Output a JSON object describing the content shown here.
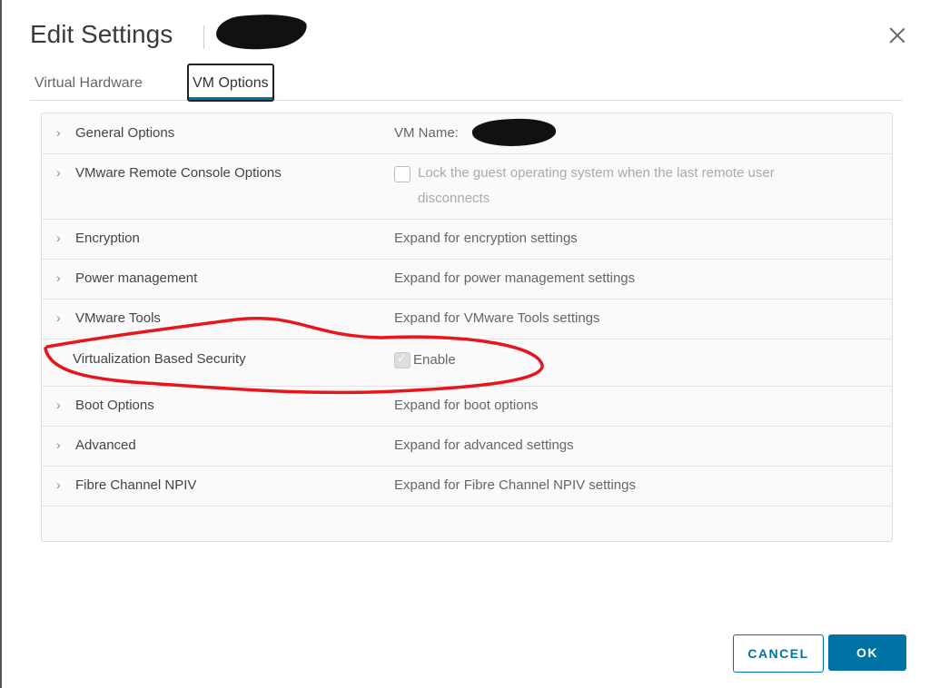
{
  "dialog": {
    "title": "Edit Settings",
    "close_icon": "close-icon"
  },
  "tabs": [
    {
      "label": "Virtual Hardware"
    },
    {
      "label": "VM Options",
      "active": true
    }
  ],
  "rows": [
    {
      "label": "General Options",
      "value": "VM Name:",
      "expandable": true
    },
    {
      "label": "VMware Remote Console Options",
      "checkbox": false,
      "value": "Lock the guest operating system when the last remote user",
      "value2": "disconnects",
      "expandable": true
    },
    {
      "label": "Encryption",
      "value": "Expand for encryption settings",
      "expandable": true
    },
    {
      "label": "Power management",
      "value": "Expand for power management settings",
      "expandable": true
    },
    {
      "label": "VMware Tools",
      "value": "Expand for VMware Tools settings",
      "expandable": true
    },
    {
      "label": "Virtualization Based Security",
      "checkbox": true,
      "value": "Enable",
      "expandable": false
    },
    {
      "label": "Boot Options",
      "value": "Expand for boot options",
      "expandable": true
    },
    {
      "label": "Advanced",
      "value": "Expand for advanced settings",
      "expandable": true
    },
    {
      "label": "Fibre Channel NPIV",
      "value": "Expand for Fibre Channel NPIV settings",
      "expandable": true
    }
  ],
  "chevron": "›",
  "footer": {
    "cancel_label": "CANCEL",
    "ok_label": "OK"
  },
  "colors": {
    "accent": "#0072a3",
    "annotation": "#e8161c"
  }
}
